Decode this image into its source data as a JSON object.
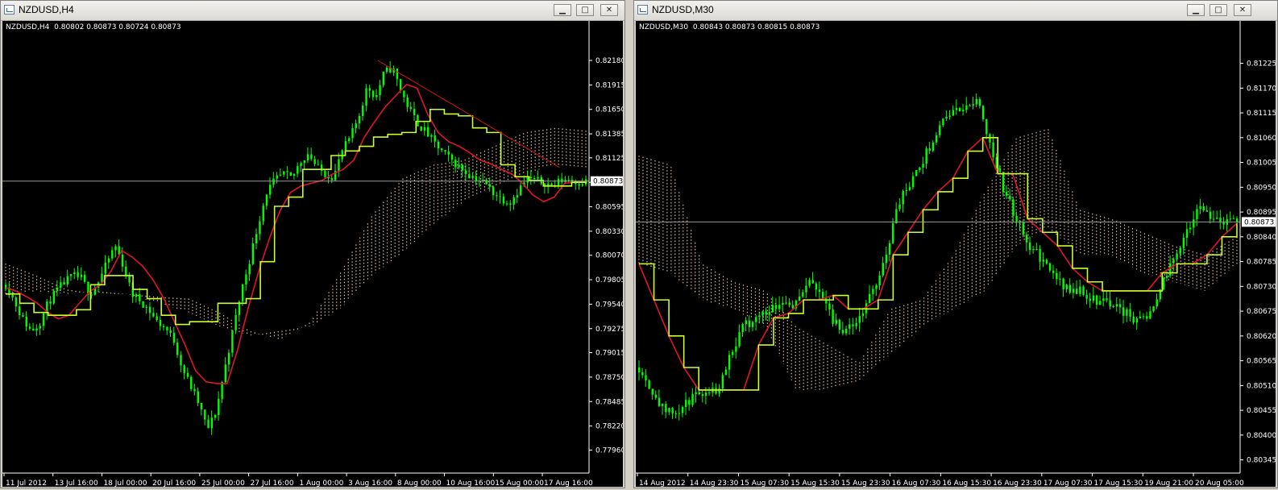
{
  "windows": [
    {
      "id": "left",
      "title": "NZDUSD,H4",
      "info": "NZDUSD,H4  0.80802 0.80873 0.80724 0.80873",
      "current_price": "0.80873",
      "controls": [
        "minimize",
        "maximize",
        "close"
      ],
      "colors": {
        "background": "#000000",
        "candles": "#00ff00",
        "tenkan": "#e0142c",
        "kijun": "#c8ff2a",
        "cloud": "#f5c8b0",
        "trendline": "#d01414",
        "price_line": "#9a9a9a"
      },
      "chart_data": {
        "type": "line",
        "title": "NZDUSD,H4",
        "xlabel": "",
        "ylabel": "",
        "ylim": [
          0.7778,
          0.8232
        ],
        "y_ticks": [
          "0.82180",
          "0.81915",
          "0.81650",
          "0.81385",
          "0.81125",
          "0.80860",
          "0.80595",
          "0.80330",
          "0.80070",
          "0.79805",
          "0.79540",
          "0.79275",
          "0.79015",
          "0.78750",
          "0.78485",
          "0.78220",
          "0.77960"
        ],
        "x_ticks": [
          "11 Jul 2012",
          "13 Jul 16:00",
          "18 Jul 00:00",
          "20 Jul 16:00",
          "25 Jul 00:00",
          "27 Jul 16:00",
          "1 Aug 00:00",
          "3 Aug 16:00",
          "8 Aug 00:00",
          "10 Aug 16:00",
          "15 Aug 00:00",
          "17 Aug 16:00"
        ],
        "bars": 170,
        "series": [
          {
            "values": [
              0.7975,
              0.7958,
              0.7938,
              0.7925,
              0.7933,
              0.7955,
              0.7968,
              0.7978,
              0.7985,
              0.7982,
              0.7965,
              0.7978,
              0.7998,
              0.8018,
              0.7995,
              0.7965,
              0.7958,
              0.7948,
              0.7935,
              0.7928,
              0.7915,
              0.7885,
              0.7865,
              0.7845,
              0.7818,
              0.7838,
              0.7882,
              0.7925,
              0.7968,
              0.8002,
              0.804,
              0.8075,
              0.8088,
              0.8095,
              0.809,
              0.8108,
              0.8118,
              0.8102,
              0.8095,
              0.8092,
              0.812,
              0.8135,
              0.8158,
              0.819,
              0.8178,
              0.8205,
              0.821,
              0.8185,
              0.8165,
              0.815,
              0.814,
              0.8128,
              0.8118,
              0.811,
              0.8102,
              0.8095,
              0.809,
              0.8085,
              0.8075,
              0.8068,
              0.8065,
              0.8078,
              0.809,
              0.8088,
              0.8086,
              0.8082,
              0.8088,
              0.809,
              0.8086,
              0.8087
            ]
          },
          {
            "values": [
              0.7972,
              0.7968,
              0.7962,
              0.7955,
              0.7945,
              0.7938,
              0.7942,
              0.7955,
              0.7968,
              0.7975,
              0.799,
              0.8012,
              0.8005,
              0.7995,
              0.798,
              0.796,
              0.7935,
              0.791,
              0.7882,
              0.787,
              0.7868,
              0.7868,
              0.7905,
              0.795,
              0.799,
              0.8025,
              0.8055,
              0.8075,
              0.8082,
              0.8085,
              0.8088,
              0.8095,
              0.81,
              0.811,
              0.8135,
              0.8152,
              0.8168,
              0.818,
              0.8192,
              0.8188,
              0.816,
              0.814,
              0.813,
              0.8125,
              0.8118,
              0.811,
              0.8106,
              0.81,
              0.8095,
              0.8085,
              0.8072,
              0.8065,
              0.807,
              0.8085,
              0.8086,
              0.8087
            ]
          },
          {
            "values": [
              0.7965,
              0.7955,
              0.7945,
              0.7942,
              0.7942,
              0.7948,
              0.7975,
              0.7985,
              0.7985,
              0.797,
              0.796,
              0.7942,
              0.7932,
              0.7935,
              0.7935,
              0.7955,
              0.7955,
              0.796,
              0.8,
              0.806,
              0.807,
              0.81,
              0.81,
              0.8115,
              0.812,
              0.8125,
              0.8135,
              0.8138,
              0.814,
              0.8152,
              0.8165,
              0.816,
              0.8158,
              0.8145,
              0.814,
              0.8105,
              0.8092,
              0.8088,
              0.8082,
              0.8082,
              0.8086,
              0.8085
            ]
          }
        ]
      }
    },
    {
      "id": "right",
      "title": "NZDUSD,M30",
      "info": "NZDUSD,M30  0.80843 0.80873 0.80815 0.80873",
      "current_price": "0.80873",
      "controls": [
        "minimize",
        "maximize",
        "close"
      ],
      "colors": {
        "background": "#000000",
        "candles": "#00ff00",
        "tenkan": "#e0142c",
        "kijun": "#c8ff2a",
        "cloud": "#f5c8b0",
        "price_line": "#9a9a9a"
      },
      "chart_data": {
        "type": "line",
        "title": "NZDUSD,M30",
        "xlabel": "",
        "ylabel": "",
        "ylim": [
          0.8033,
          0.8126
        ],
        "y_ticks": [
          "0.81225",
          "0.81170",
          "0.81115",
          "0.81060",
          "0.81005",
          "0.80950",
          "0.80895",
          "0.80840",
          "0.80785",
          "0.80730",
          "0.80675",
          "0.80620",
          "0.80565",
          "0.80510",
          "0.80455",
          "0.80400",
          "0.80345"
        ],
        "x_ticks": [
          "14 Aug 2012",
          "14 Aug 23:30",
          "15 Aug 07:30",
          "15 Aug 15:30",
          "15 Aug 23:30",
          "16 Aug 07:30",
          "16 Aug 15:30",
          "16 Aug 23:30",
          "17 Aug 07:30",
          "17 Aug 15:30",
          "19 Aug 21:00",
          "20 Aug 05:00"
        ],
        "bars": 180,
        "series": [
          {
            "values": [
              0.8055,
              0.805,
              0.8045,
              0.8045,
              0.8048,
              0.805,
              0.805,
              0.8058,
              0.8064,
              0.8066,
              0.8068,
              0.807,
              0.8069,
              0.8074,
              0.8072,
              0.8065,
              0.8063,
              0.8066,
              0.8072,
              0.808,
              0.8092,
              0.8096,
              0.8102,
              0.8108,
              0.8112,
              0.8112,
              0.8115,
              0.8105,
              0.8095,
              0.8088,
              0.8082,
              0.8079,
              0.8075,
              0.8072,
              0.8072,
              0.807,
              0.807,
              0.8068,
              0.8066,
              0.8066,
              0.8072,
              0.8078,
              0.8085,
              0.809,
              0.8089,
              0.8087,
              0.8087
            ]
          },
          {
            "values": [
              0.8078,
              0.807,
              0.8062,
              0.8055,
              0.805,
              0.805,
              0.805,
              0.805,
              0.806,
              0.8066,
              0.8067,
              0.807,
              0.807,
              0.8071,
              0.8068,
              0.8068,
              0.807,
              0.808,
              0.8085,
              0.809,
              0.8094,
              0.8097,
              0.8103,
              0.8106,
              0.8098,
              0.8098,
              0.8088,
              0.8085,
              0.8082,
              0.8077,
              0.8074,
              0.8072,
              0.8072,
              0.8072,
              0.8072,
              0.8076,
              0.8078,
              0.8078,
              0.808,
              0.8084,
              0.8087
            ]
          }
        ]
      }
    }
  ]
}
